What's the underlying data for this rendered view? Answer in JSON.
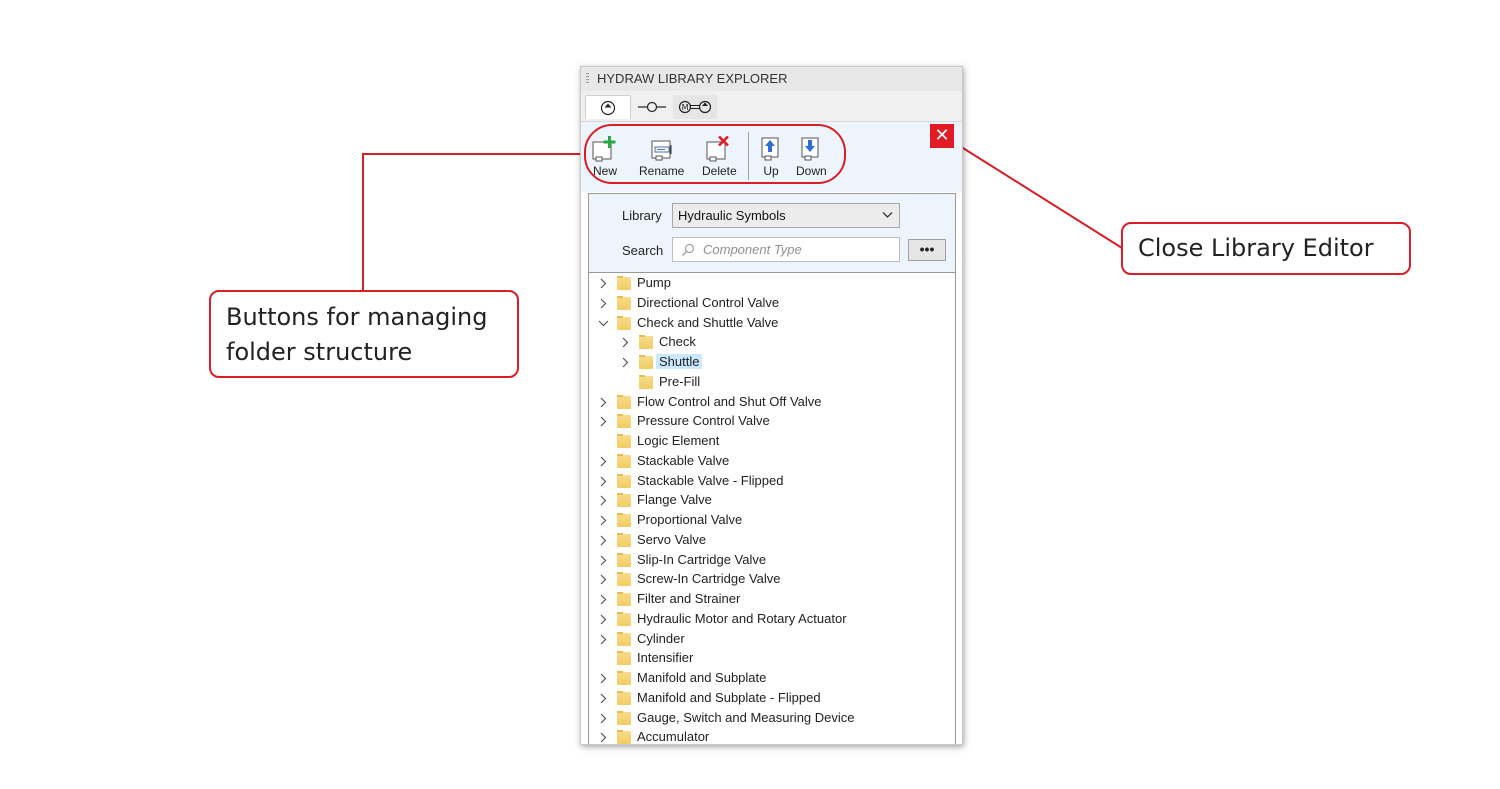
{
  "panel": {
    "title": "HYDRAW LIBRARY EXPLORER",
    "tabs": [
      {
        "icon": "pump-symbol-icon"
      },
      {
        "icon": "valve-line-symbol-icon"
      },
      {
        "icon": "motor-symbol-icon"
      }
    ],
    "toolbar": {
      "new_label": "New",
      "rename_label": "Rename",
      "delete_label": "Delete",
      "up_label": "Up",
      "down_label": "Down"
    },
    "close_label": "✕",
    "filter": {
      "library_label": "Library",
      "library_value": "Hydraulic Symbols",
      "search_label": "Search",
      "search_placeholder": "Component Type",
      "more_label": "•••"
    },
    "tree": [
      {
        "label": "Pump",
        "level": 0,
        "expander": "collapsed"
      },
      {
        "label": "Directional Control Valve",
        "level": 0,
        "expander": "collapsed"
      },
      {
        "label": "Check and Shuttle Valve",
        "level": 0,
        "expander": "expanded"
      },
      {
        "label": "Check",
        "level": 1,
        "expander": "collapsed"
      },
      {
        "label": "Shuttle",
        "level": 1,
        "expander": "collapsed",
        "selected": true
      },
      {
        "label": "Pre-Fill",
        "level": 1,
        "expander": "none"
      },
      {
        "label": "Flow Control and Shut Off Valve",
        "level": 0,
        "expander": "collapsed"
      },
      {
        "label": "Pressure Control Valve",
        "level": 0,
        "expander": "collapsed"
      },
      {
        "label": "Logic Element",
        "level": 0,
        "expander": "none"
      },
      {
        "label": "Stackable Valve",
        "level": 0,
        "expander": "collapsed"
      },
      {
        "label": "Stackable Valve - Flipped",
        "level": 0,
        "expander": "collapsed"
      },
      {
        "label": "Flange Valve",
        "level": 0,
        "expander": "collapsed"
      },
      {
        "label": "Proportional Valve",
        "level": 0,
        "expander": "collapsed"
      },
      {
        "label": "Servo Valve",
        "level": 0,
        "expander": "collapsed"
      },
      {
        "label": "Slip-In Cartridge Valve",
        "level": 0,
        "expander": "collapsed"
      },
      {
        "label": "Screw-In Cartridge Valve",
        "level": 0,
        "expander": "collapsed"
      },
      {
        "label": "Filter and Strainer",
        "level": 0,
        "expander": "collapsed"
      },
      {
        "label": "Hydraulic Motor and Rotary Actuator",
        "level": 0,
        "expander": "collapsed"
      },
      {
        "label": "Cylinder",
        "level": 0,
        "expander": "collapsed"
      },
      {
        "label": "Intensifier",
        "level": 0,
        "expander": "none"
      },
      {
        "label": "Manifold and Subplate",
        "level": 0,
        "expander": "collapsed"
      },
      {
        "label": "Manifold and Subplate - Flipped",
        "level": 0,
        "expander": "collapsed"
      },
      {
        "label": "Gauge, Switch and Measuring Device",
        "level": 0,
        "expander": "collapsed"
      },
      {
        "label": "Accumulator",
        "level": 0,
        "expander": "collapsed"
      }
    ]
  },
  "annotations": {
    "buttons_callout_line1": "Buttons for managing",
    "buttons_callout_line2": "folder structure",
    "close_callout": "Close Library Editor"
  },
  "colors": {
    "accent_red": "#d81e27",
    "close_button": "#e21b23",
    "selection": "#cce8ff",
    "toolbar_bg": "#eef4fb"
  }
}
